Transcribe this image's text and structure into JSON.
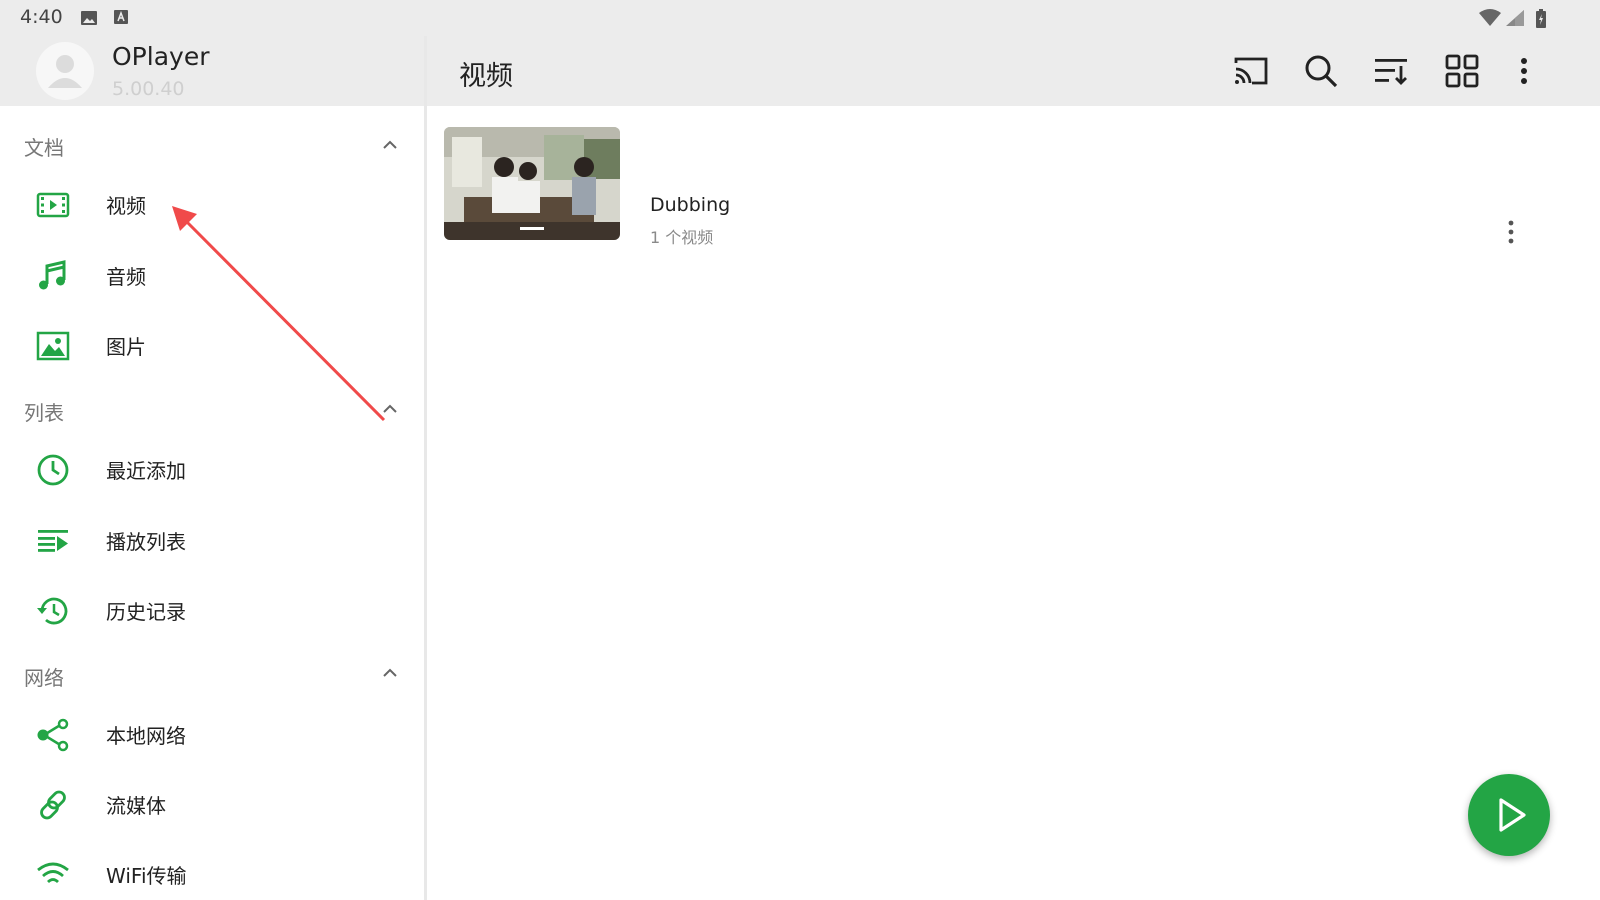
{
  "status_bar": {
    "time": "4:40"
  },
  "drawer": {
    "app_name": "OPlayer",
    "app_version": "5.00.40",
    "sections": [
      {
        "label": "文档",
        "items": [
          {
            "label": "视频",
            "icon": "video-icon"
          },
          {
            "label": "音频",
            "icon": "music-icon"
          },
          {
            "label": "图片",
            "icon": "image-icon"
          }
        ]
      },
      {
        "label": "列表",
        "items": [
          {
            "label": "最近添加",
            "icon": "clock-icon"
          },
          {
            "label": "播放列表",
            "icon": "playlist-icon"
          },
          {
            "label": "历史记录",
            "icon": "history-icon"
          }
        ]
      },
      {
        "label": "网络",
        "items": [
          {
            "label": "本地网络",
            "icon": "share-icon"
          },
          {
            "label": "流媒体",
            "icon": "link-icon"
          },
          {
            "label": "WiFi传输",
            "icon": "wifi-icon"
          }
        ]
      }
    ]
  },
  "appbar": {
    "title": "视频",
    "actions": [
      "cast-icon",
      "search-icon",
      "sort-icon",
      "grid-view-icon",
      "more-vert-icon"
    ]
  },
  "folders": [
    {
      "name": "Dubbing",
      "count": "1 个视频"
    }
  ],
  "colors": {
    "accent": "#23a545",
    "annotation": "#f04a4a"
  }
}
